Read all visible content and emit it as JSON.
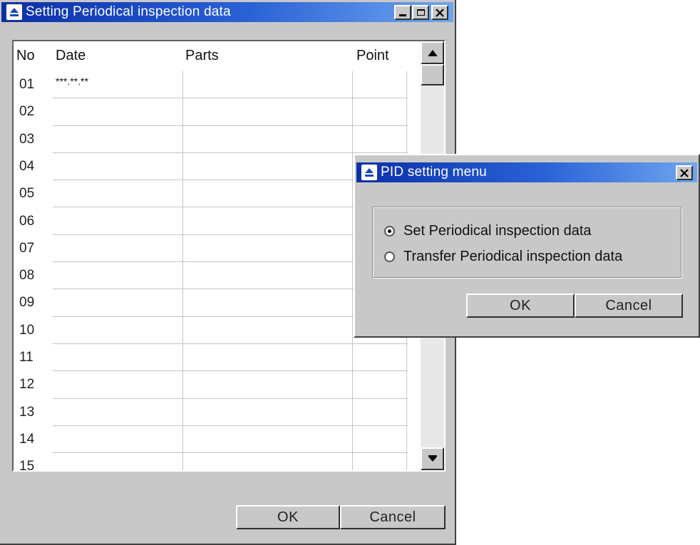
{
  "main_window": {
    "title": "Setting Periodical inspection data",
    "columns": [
      "No",
      "Date",
      "Parts",
      "Point"
    ],
    "rows": [
      {
        "no": "01",
        "date": "***.**.**"
      },
      {
        "no": "02",
        "date": ""
      },
      {
        "no": "03",
        "date": ""
      },
      {
        "no": "04",
        "date": ""
      },
      {
        "no": "05",
        "date": ""
      },
      {
        "no": "06",
        "date": ""
      },
      {
        "no": "07",
        "date": ""
      },
      {
        "no": "08",
        "date": ""
      },
      {
        "no": "09",
        "date": ""
      },
      {
        "no": "10",
        "date": ""
      },
      {
        "no": "11",
        "date": ""
      },
      {
        "no": "12",
        "date": ""
      },
      {
        "no": "13",
        "date": ""
      },
      {
        "no": "14",
        "date": ""
      },
      {
        "no": "15",
        "date": ""
      }
    ],
    "ok_label": "OK",
    "cancel_label": "Cancel"
  },
  "dialog": {
    "title": "PID setting menu",
    "options": [
      {
        "label": "Set Periodical inspection data",
        "selected": true
      },
      {
        "label": "Transfer Periodical inspection data",
        "selected": false
      }
    ],
    "ok_label": "OK",
    "cancel_label": "Cancel"
  },
  "icons": {
    "app": "eject-icon",
    "minimize": "minimize-icon",
    "maximize": "maximize-icon",
    "close": "close-icon",
    "scroll_up": "arrow-up-icon",
    "scroll_down": "arrow-down-icon"
  },
  "colors": {
    "titlebar_start": "#0a2fa8",
    "titlebar_end": "#6fa6f0",
    "window_face": "#c8c8c8"
  }
}
